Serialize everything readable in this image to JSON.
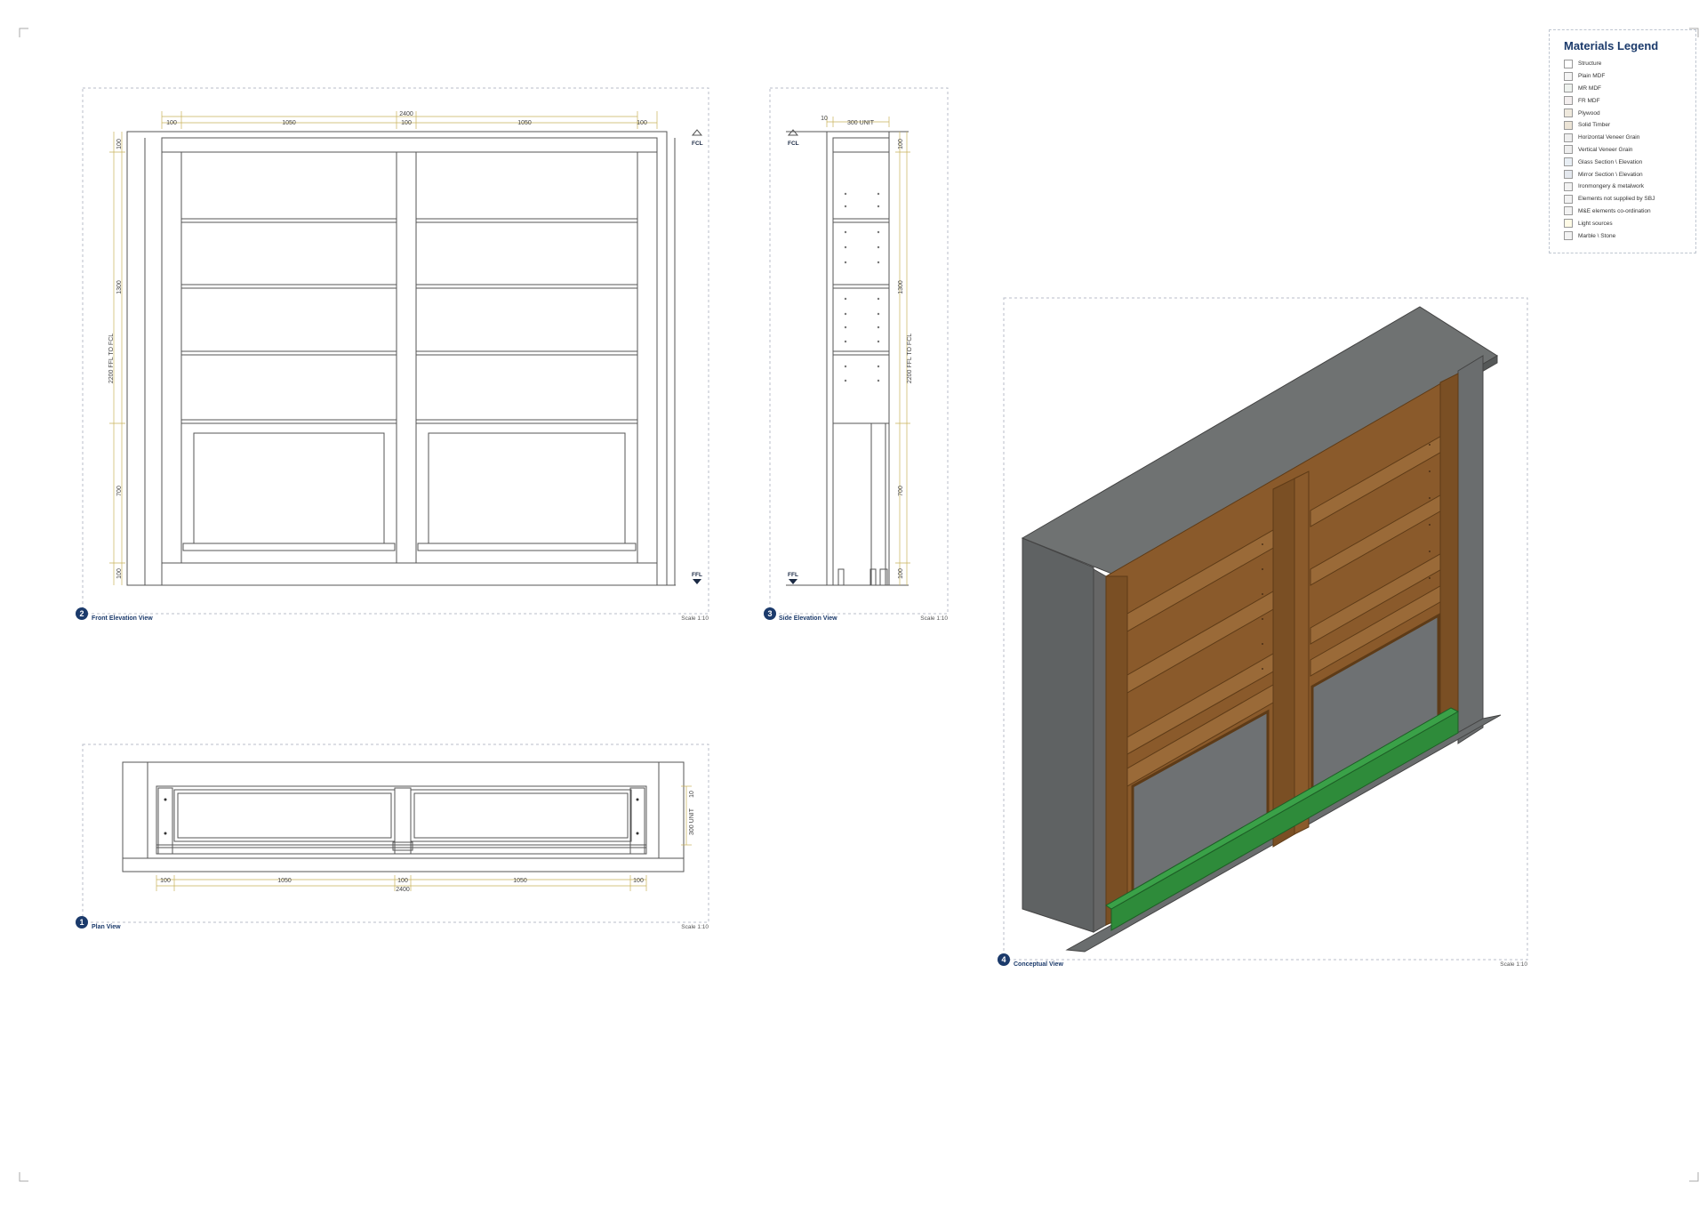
{
  "legend": {
    "title": "Materials Legend",
    "items": [
      {
        "label": "Structure",
        "color": "#ffffff"
      },
      {
        "label": "Plain MDF",
        "color": "#f4f4f4"
      },
      {
        "label": "MR MDF",
        "color": "#eef2ee"
      },
      {
        "label": "FR MDF",
        "color": "#f3eeee"
      },
      {
        "label": "Plywood",
        "color": "#efe9dd"
      },
      {
        "label": "Solid Timber",
        "color": "#ece4d6"
      },
      {
        "label": "Horizontal Veneer Grain",
        "color": "#eeeeee"
      },
      {
        "label": "Vertical Veneer Grain",
        "color": "#eeeeee"
      },
      {
        "label": "Glass Section \\ Elevation",
        "color": "#e8eef4"
      },
      {
        "label": "Mirror Section \\ Elevation",
        "color": "#e4e8ee"
      },
      {
        "label": "Ironmongery & metalwork",
        "color": "#f2f2f2"
      },
      {
        "label": "Elements not supplied by SBJ",
        "color": "#f2f2f2"
      },
      {
        "label": "M&E elements co-ordination",
        "color": "#f2f2f2"
      },
      {
        "label": "Light sources",
        "color": "#fffbe6"
      },
      {
        "label": "Marble \\ Stone",
        "color": "#f2f2f2"
      }
    ]
  },
  "views": {
    "front": {
      "number": "2",
      "title": "Front Elevation View",
      "scale": "Scale 1:10"
    },
    "side": {
      "number": "3",
      "title": "Side Elevation View",
      "scale": "Scale 1:10"
    },
    "plan": {
      "number": "1",
      "title": "Plan View",
      "scale": "Scale 1:10"
    },
    "conceptual": {
      "number": "4",
      "title": "Conceptual View",
      "scale": "Scale 1:10"
    }
  },
  "front_dims": {
    "overall": "2400",
    "left": "100",
    "bay_left": "1050",
    "mid": "100",
    "bay_right": "1050",
    "right": "100",
    "v_top": "100",
    "v_upper": "1300",
    "v_lower": "700",
    "v_bottom": "100",
    "v_total": "2200 FFL TO FCL",
    "fcl": "FCL",
    "ffl": "FFL"
  },
  "side_dims": {
    "depth": "300 UNIT",
    "offset": "10",
    "v_top": "100",
    "v_upper": "1300",
    "v_lower": "700",
    "v_bottom": "100",
    "v_total": "2200 FFL TO FCL",
    "fcl": "FCL",
    "ffl": "FFL"
  },
  "plan_dims": {
    "overall": "2400",
    "left": "100",
    "bay_left": "1050",
    "mid": "100",
    "bay_right": "1050",
    "right": "100",
    "depth": "300 UNIT",
    "offset": "10"
  },
  "colors": {
    "line": "#555555",
    "dash": "#b8bec8",
    "dimline": "#c9b25a",
    "timber": "#8a5a2b",
    "timber_dark": "#5e3b17",
    "grey_panel": "#6e7173",
    "grey_top": "#6f7272",
    "kick_green": "#2e8b3a",
    "badge": "#1b3a6b"
  }
}
